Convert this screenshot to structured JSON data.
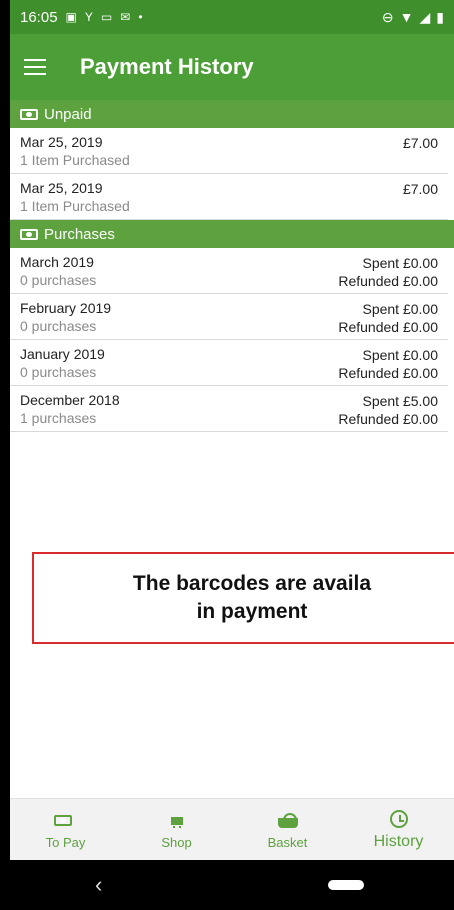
{
  "status": {
    "time": "16:05",
    "icons_left": [
      "image-icon",
      "antenna-icon",
      "sim-icon",
      "mail-icon",
      "dot-icon"
    ],
    "icons_right": [
      "dnd-icon",
      "wifi-icon",
      "signal-icon",
      "battery-icon"
    ]
  },
  "header": {
    "title": "Payment History"
  },
  "sections": {
    "unpaid": {
      "title": "Unpaid",
      "items": [
        {
          "date": "Mar 25, 2019",
          "sub": "1 Item Purchased",
          "amount": "£7.00"
        },
        {
          "date": "Mar 25, 2019",
          "sub": "1 Item Purchased",
          "amount": "£7.00"
        }
      ]
    },
    "purchases": {
      "title": "Purchases",
      "items": [
        {
          "month": "March 2019",
          "sub": "0 purchases",
          "spent": "Spent £0.00",
          "refunded": "Refunded £0.00"
        },
        {
          "month": "February 2019",
          "sub": "0 purchases",
          "spent": "Spent £0.00",
          "refunded": "Refunded £0.00"
        },
        {
          "month": "January 2019",
          "sub": "0 purchases",
          "spent": "Spent £0.00",
          "refunded": "Refunded £0.00"
        },
        {
          "month": "December 2018",
          "sub": "1 purchases",
          "spent": "Spent £5.00",
          "refunded": "Refunded £0.00"
        }
      ]
    }
  },
  "callout": {
    "line1": "The barcodes are availa",
    "line2": "in payment"
  },
  "nav": {
    "items": [
      {
        "label": "To Pay",
        "icon": "money-icon"
      },
      {
        "label": "Shop",
        "icon": "cart-icon"
      },
      {
        "label": "Basket",
        "icon": "basket-icon"
      },
      {
        "label": "History",
        "icon": "clock-icon"
      }
    ]
  },
  "colors": {
    "status_bar": "#3f8f2d",
    "app_bar": "#4c9e36",
    "section": "#5ea13f",
    "callout_border": "#d92b2b"
  }
}
